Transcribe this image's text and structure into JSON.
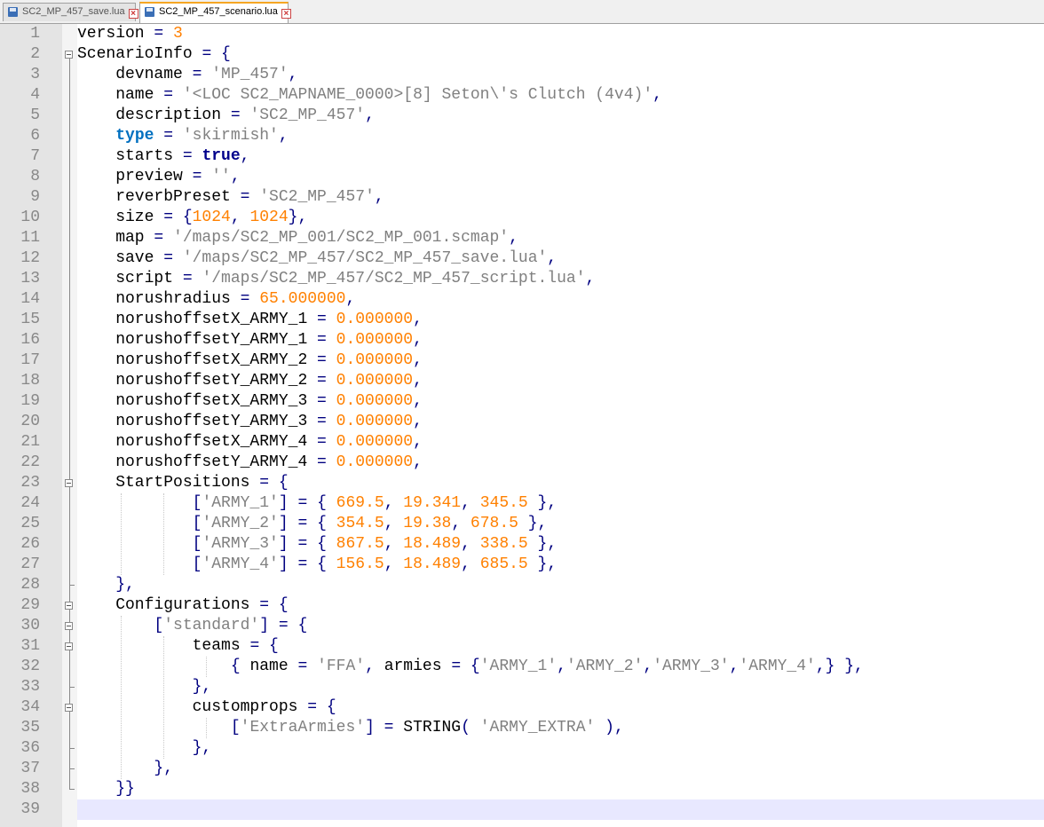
{
  "tabs": [
    {
      "label": "SC2_MP_457_save.lua",
      "active": false
    },
    {
      "label": "SC2_MP_457_scenario.lua",
      "active": true
    }
  ],
  "colors": {
    "text": "#000000",
    "operator": "#000080",
    "string": "#808080",
    "number": "#ff8000",
    "keyword_blue": "#0070c0",
    "keyword_navy": "#00008b",
    "line_number": "#888888",
    "current_line": "#e8e8ff"
  },
  "current_line": 39,
  "lines": [
    [
      [
        "version ",
        "t"
      ],
      [
        "= ",
        "o"
      ],
      [
        "3",
        "n"
      ]
    ],
    [
      [
        "ScenarioInfo ",
        "t"
      ],
      [
        "= {",
        "o"
      ]
    ],
    [
      [
        "    devname ",
        "t"
      ],
      [
        "= ",
        "o"
      ],
      [
        "'MP_457'",
        "s"
      ],
      [
        ",",
        "o"
      ]
    ],
    [
      [
        "    name ",
        "t"
      ],
      [
        "= ",
        "o"
      ],
      [
        "'<LOC SC2_MAPNAME_0000>[8] Seton\\'s Clutch (4v4)'",
        "s"
      ],
      [
        ",",
        "o"
      ]
    ],
    [
      [
        "    description ",
        "t"
      ],
      [
        "= ",
        "o"
      ],
      [
        "'SC2_MP_457'",
        "s"
      ],
      [
        ",",
        "o"
      ]
    ],
    [
      [
        "    ",
        "t"
      ],
      [
        "type",
        "k"
      ],
      [
        " = ",
        "o"
      ],
      [
        "'skirmish'",
        "s"
      ],
      [
        ",",
        "o"
      ]
    ],
    [
      [
        "    starts ",
        "t"
      ],
      [
        "= ",
        "o"
      ],
      [
        "true",
        "b"
      ],
      [
        ",",
        "o"
      ]
    ],
    [
      [
        "    preview ",
        "t"
      ],
      [
        "= ",
        "o"
      ],
      [
        "''",
        "s"
      ],
      [
        ",",
        "o"
      ]
    ],
    [
      [
        "    reverbPreset ",
        "t"
      ],
      [
        "= ",
        "o"
      ],
      [
        "'SC2_MP_457'",
        "s"
      ],
      [
        ",",
        "o"
      ]
    ],
    [
      [
        "    size ",
        "t"
      ],
      [
        "= {",
        "o"
      ],
      [
        "1024",
        "n"
      ],
      [
        ", ",
        "o"
      ],
      [
        "1024",
        "n"
      ],
      [
        "},",
        "o"
      ]
    ],
    [
      [
        "    map ",
        "t"
      ],
      [
        "= ",
        "o"
      ],
      [
        "'/maps/SC2_MP_001/SC2_MP_001.scmap'",
        "s"
      ],
      [
        ",",
        "o"
      ]
    ],
    [
      [
        "    save ",
        "t"
      ],
      [
        "= ",
        "o"
      ],
      [
        "'/maps/SC2_MP_457/SC2_MP_457_save.lua'",
        "s"
      ],
      [
        ",",
        "o"
      ]
    ],
    [
      [
        "    script ",
        "t"
      ],
      [
        "= ",
        "o"
      ],
      [
        "'/maps/SC2_MP_457/SC2_MP_457_script.lua'",
        "s"
      ],
      [
        ",",
        "o"
      ]
    ],
    [
      [
        "    norushradius ",
        "t"
      ],
      [
        "= ",
        "o"
      ],
      [
        "65.000000",
        "n"
      ],
      [
        ",",
        "o"
      ]
    ],
    [
      [
        "    norushoffsetX_ARMY_1 ",
        "t"
      ],
      [
        "= ",
        "o"
      ],
      [
        "0.000000",
        "n"
      ],
      [
        ",",
        "o"
      ]
    ],
    [
      [
        "    norushoffsetY_ARMY_1 ",
        "t"
      ],
      [
        "= ",
        "o"
      ],
      [
        "0.000000",
        "n"
      ],
      [
        ",",
        "o"
      ]
    ],
    [
      [
        "    norushoffsetX_ARMY_2 ",
        "t"
      ],
      [
        "= ",
        "o"
      ],
      [
        "0.000000",
        "n"
      ],
      [
        ",",
        "o"
      ]
    ],
    [
      [
        "    norushoffsetY_ARMY_2 ",
        "t"
      ],
      [
        "= ",
        "o"
      ],
      [
        "0.000000",
        "n"
      ],
      [
        ",",
        "o"
      ]
    ],
    [
      [
        "    norushoffsetX_ARMY_3 ",
        "t"
      ],
      [
        "= ",
        "o"
      ],
      [
        "0.000000",
        "n"
      ],
      [
        ",",
        "o"
      ]
    ],
    [
      [
        "    norushoffsetY_ARMY_3 ",
        "t"
      ],
      [
        "= ",
        "o"
      ],
      [
        "0.000000",
        "n"
      ],
      [
        ",",
        "o"
      ]
    ],
    [
      [
        "    norushoffsetX_ARMY_4 ",
        "t"
      ],
      [
        "= ",
        "o"
      ],
      [
        "0.000000",
        "n"
      ],
      [
        ",",
        "o"
      ]
    ],
    [
      [
        "    norushoffsetY_ARMY_4 ",
        "t"
      ],
      [
        "= ",
        "o"
      ],
      [
        "0.000000",
        "n"
      ],
      [
        ",",
        "o"
      ]
    ],
    [
      [
        "    StartPositions ",
        "t"
      ],
      [
        "= {",
        "o"
      ]
    ],
    [
      [
        "            [",
        "o"
      ],
      [
        "'ARMY_1'",
        "s"
      ],
      [
        "] = { ",
        "o"
      ],
      [
        "669.5",
        "n"
      ],
      [
        ", ",
        "o"
      ],
      [
        "19.341",
        "n"
      ],
      [
        ", ",
        "o"
      ],
      [
        "345.5",
        "n"
      ],
      [
        " },",
        "o"
      ]
    ],
    [
      [
        "            [",
        "o"
      ],
      [
        "'ARMY_2'",
        "s"
      ],
      [
        "] = { ",
        "o"
      ],
      [
        "354.5",
        "n"
      ],
      [
        ", ",
        "o"
      ],
      [
        "19.38",
        "n"
      ],
      [
        ", ",
        "o"
      ],
      [
        "678.5",
        "n"
      ],
      [
        " },",
        "o"
      ]
    ],
    [
      [
        "            [",
        "o"
      ],
      [
        "'ARMY_3'",
        "s"
      ],
      [
        "] = { ",
        "o"
      ],
      [
        "867.5",
        "n"
      ],
      [
        ", ",
        "o"
      ],
      [
        "18.489",
        "n"
      ],
      [
        ", ",
        "o"
      ],
      [
        "338.5",
        "n"
      ],
      [
        " },",
        "o"
      ]
    ],
    [
      [
        "            [",
        "o"
      ],
      [
        "'ARMY_4'",
        "s"
      ],
      [
        "] = { ",
        "o"
      ],
      [
        "156.5",
        "n"
      ],
      [
        ", ",
        "o"
      ],
      [
        "18.489",
        "n"
      ],
      [
        ", ",
        "o"
      ],
      [
        "685.5",
        "n"
      ],
      [
        " },",
        "o"
      ]
    ],
    [
      [
        "    },",
        "o"
      ]
    ],
    [
      [
        "    Configurations ",
        "t"
      ],
      [
        "= {",
        "o"
      ]
    ],
    [
      [
        "        [",
        "o"
      ],
      [
        "'standard'",
        "s"
      ],
      [
        "] = {",
        "o"
      ]
    ],
    [
      [
        "            teams ",
        "t"
      ],
      [
        "= {",
        "o"
      ]
    ],
    [
      [
        "                { ",
        "o"
      ],
      [
        "name ",
        "t"
      ],
      [
        "= ",
        "o"
      ],
      [
        "'FFA'",
        "s"
      ],
      [
        ", ",
        "o"
      ],
      [
        "armies ",
        "t"
      ],
      [
        "= {",
        "o"
      ],
      [
        "'ARMY_1'",
        "s"
      ],
      [
        ",",
        "o"
      ],
      [
        "'ARMY_2'",
        "s"
      ],
      [
        ",",
        "o"
      ],
      [
        "'ARMY_3'",
        "s"
      ],
      [
        ",",
        "o"
      ],
      [
        "'ARMY_4'",
        "s"
      ],
      [
        ",} },",
        "o"
      ]
    ],
    [
      [
        "            },",
        "o"
      ]
    ],
    [
      [
        "            customprops ",
        "t"
      ],
      [
        "= {",
        "o"
      ]
    ],
    [
      [
        "                [",
        "o"
      ],
      [
        "'ExtraArmies'",
        "s"
      ],
      [
        "] = ",
        "o"
      ],
      [
        "STRING",
        "t"
      ],
      [
        "( ",
        "o"
      ],
      [
        "'ARMY_EXTRA'",
        "s"
      ],
      [
        " ),",
        "o"
      ]
    ],
    [
      [
        "            },",
        "o"
      ]
    ],
    [
      [
        "        },",
        "o"
      ]
    ],
    [
      [
        "    }}",
        "o"
      ]
    ],
    [
      [
        "",
        "t"
      ]
    ]
  ]
}
